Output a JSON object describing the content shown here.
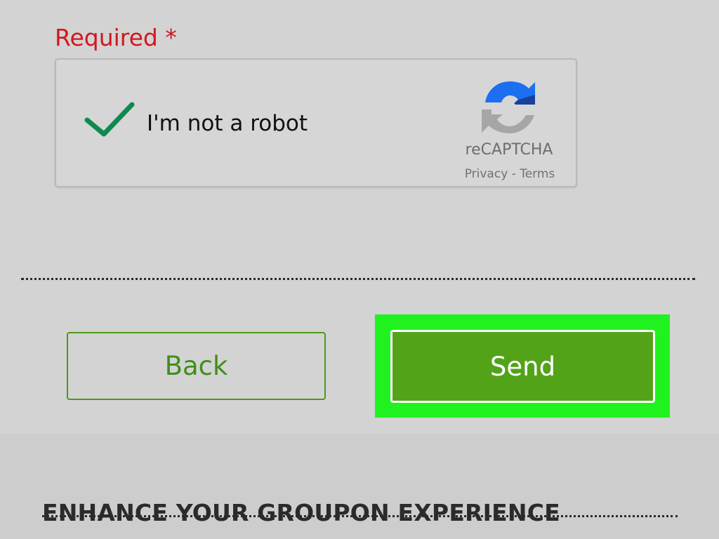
{
  "form": {
    "required_label": "Required *"
  },
  "captcha": {
    "checkbox_label": "I'm not a robot",
    "checked": true,
    "brand_name": "reCAPTCHA",
    "privacy_link": "Privacy",
    "separator": " - ",
    "terms_link": "Terms",
    "check_color": "#0f8a4f",
    "logo_blue": "#1c6ff0",
    "logo_dark_blue": "#1b3f9c",
    "logo_gray": "#a6a6a6"
  },
  "actions": {
    "back_label": "Back",
    "send_label": "Send",
    "accent_color": "#53a318",
    "highlight_color": "#1ff21f"
  },
  "section": {
    "title": "ENHANCE YOUR GROUPON EXPERIENCE"
  }
}
